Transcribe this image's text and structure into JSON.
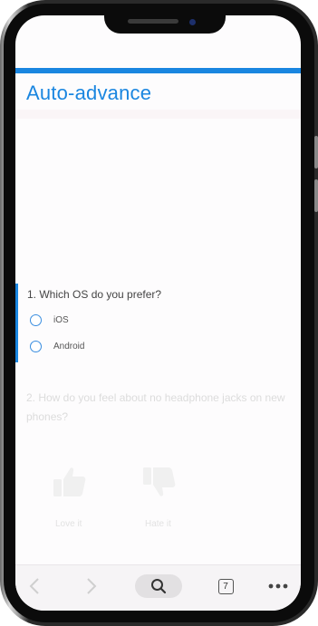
{
  "page": {
    "title": "Auto-advance",
    "accent_color": "#1a86e0"
  },
  "question1": {
    "text": "1. Which OS do you prefer?",
    "options": [
      {
        "label": "iOS",
        "selected": false
      },
      {
        "label": "Android",
        "selected": false
      }
    ]
  },
  "question2": {
    "text": "2. How do you feel about no headphone jacks on new phones?",
    "options": [
      {
        "label": "Love it",
        "icon": "thumbs-up-icon"
      },
      {
        "label": "Hate it",
        "icon": "thumbs-down-icon"
      }
    ]
  },
  "toolbar": {
    "back_icon": "chevron-left-icon",
    "forward_icon": "chevron-right-icon",
    "search_icon": "search-icon",
    "tab_count": "7",
    "menu_icon": "more-horizontal-icon"
  }
}
